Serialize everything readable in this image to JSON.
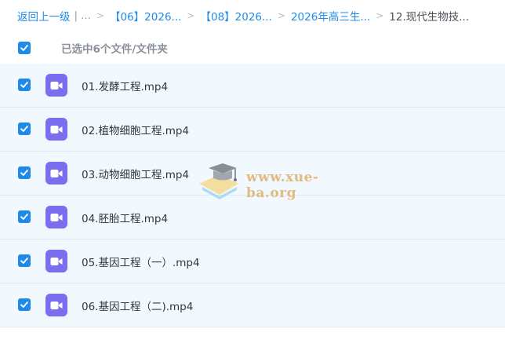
{
  "breadcrumb": {
    "back": "返回上一级",
    "divider": "|",
    "ellipsis": "...",
    "separator": ">",
    "items": [
      "【06】2026...",
      "【08】2026...",
      "2026年高三生..."
    ],
    "current": "12.现代生物技..."
  },
  "selection": {
    "checked": true,
    "summary": "已选中6个文件/文件夹"
  },
  "files": [
    {
      "name": "01.发酵工程.mp4",
      "checked": true,
      "icon": "video-file-icon"
    },
    {
      "name": "02.植物细胞工程.mp4",
      "checked": true,
      "icon": "video-file-icon"
    },
    {
      "name": "03.动物细胞工程.mp4",
      "checked": true,
      "icon": "video-file-icon"
    },
    {
      "name": "04.胚胎工程.mp4",
      "checked": true,
      "icon": "video-file-icon"
    },
    {
      "name": "05.基因工程（一）.mp4",
      "checked": true,
      "icon": "video-file-icon"
    },
    {
      "name": "06.基因工程（二).mp4",
      "checked": true,
      "icon": "video-file-icon"
    }
  ],
  "watermark": {
    "text": "www.xue-ba.org"
  },
  "colors": {
    "accent": "#1f8be8",
    "row_bg": "#f1f9fe",
    "video_icon": "#7b6cf0",
    "watermark": "#e0b06a"
  }
}
